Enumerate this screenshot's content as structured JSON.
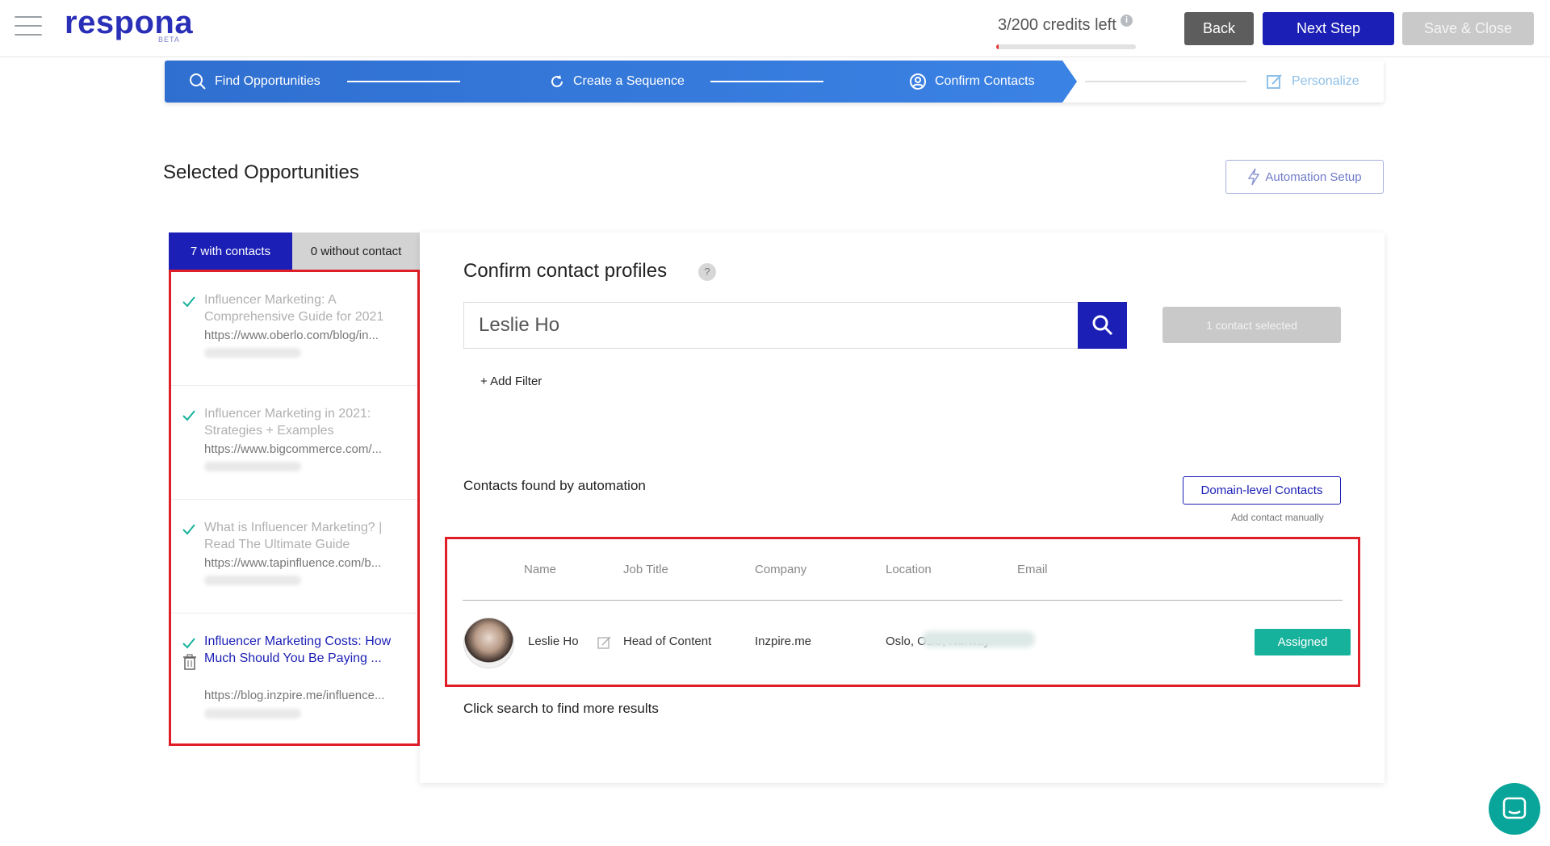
{
  "app": {
    "logo": "respona",
    "logo_badge": "BETA"
  },
  "header": {
    "credits_text": "3/200 credits left",
    "credits_used_fraction": 0.015,
    "back_label": "Back",
    "next_label": "Next Step",
    "save_label": "Save & Close"
  },
  "stepper": {
    "steps": [
      {
        "label": "Find Opportunities",
        "icon": "search-icon",
        "state": "done"
      },
      {
        "label": "Create a Sequence",
        "icon": "refresh-icon",
        "state": "done"
      },
      {
        "label": "Confirm Contacts",
        "icon": "user-circle-icon",
        "state": "current"
      },
      {
        "label": "Personalize",
        "icon": "edit-icon",
        "state": "upcoming"
      }
    ]
  },
  "page": {
    "title": "Selected Opportunities",
    "automation_setup_label": "Automation Setup"
  },
  "left_panel": {
    "tabs": [
      {
        "label": "7 with contacts",
        "active": true
      },
      {
        "label": "0 without contact",
        "active": false
      }
    ],
    "opportunities": [
      {
        "title": "Influencer Marketing: A Comprehensive Guide for 2021",
        "url": "https://www.oberlo.com/blog/in...",
        "active": false
      },
      {
        "title": "Influencer Marketing in 2021: Strategies + Examples",
        "url": "https://www.bigcommerce.com/...",
        "active": false
      },
      {
        "title": "What is Influencer Marketing? | Read The Ultimate Guide",
        "url": "https://www.tapinfluence.com/b...",
        "active": false
      },
      {
        "title": "Influencer Marketing Costs: How Much Should You Be Paying ...",
        "url": "https://blog.inzpire.me/influence...",
        "active": true
      }
    ]
  },
  "right_panel": {
    "title": "Confirm contact profiles",
    "help": "?",
    "search_value": "Leslie Ho",
    "contact_selected": "1 contact selected",
    "add_filter": "+ Add Filter",
    "contacts_found": "Contacts found by automation",
    "domain_contacts_label": "Domain-level Contacts",
    "add_manually": "Add contact manually",
    "table": {
      "headers": [
        "Name",
        "Job Title",
        "Company",
        "Location",
        "Email"
      ],
      "rows": [
        {
          "name": "Leslie Ho",
          "job_title": "Head of Content",
          "company": "Inzpire.me",
          "location": "Oslo, Oslo, Norway",
          "status": "Assigned"
        }
      ]
    },
    "more_results": "Click search to find more results"
  },
  "colors": {
    "brand": "#1b1fb5",
    "stepper": "#3a82e4",
    "assigned": "#17b29c",
    "highlight": "#e01e28"
  }
}
